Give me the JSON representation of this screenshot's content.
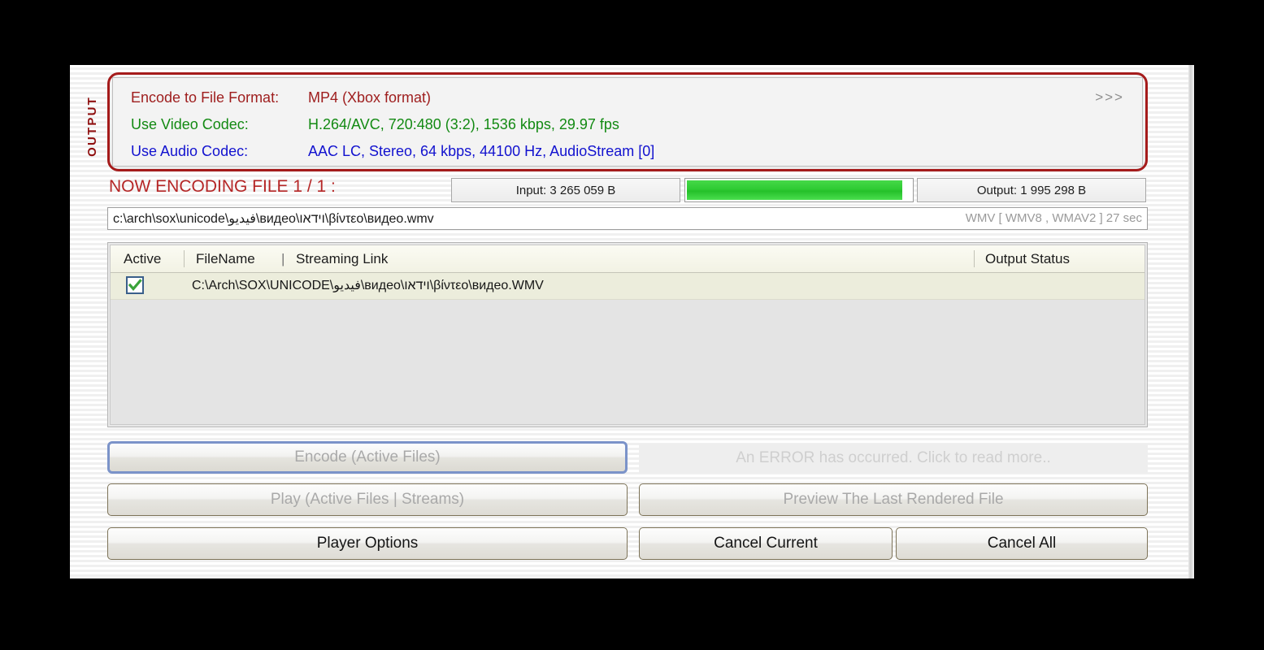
{
  "output_panel": {
    "tab_label": "OUTPUT",
    "more_arrows": ">>>",
    "rows": [
      {
        "label": "Encode to File Format:",
        "value": "MP4 (Xbox format)",
        "color": "#9e1d1d"
      },
      {
        "label": "Use Video Codec:",
        "value": "H.264/AVC,  720:480 (3:2),  1536 kbps,  29.97 fps",
        "color": "#138a13"
      },
      {
        "label": "Use Audio Codec:",
        "value": "AAC LC,  Stereo,  64 kbps,  44100 Hz,  AudioStream [0]",
        "color": "#1212cf"
      }
    ]
  },
  "status": {
    "now_encoding": "NOW ENCODING FILE 1 / 1 :",
    "input_size": "Input: 3 265 059 B",
    "output_size": "Output: 1 995 298 B",
    "progress_percent": 96
  },
  "current_file": {
    "path": "c:\\arch\\sox\\unicode\\فيديو\\видео\\וידאו\\βίντεο\\видео.wmv",
    "info": "WMV [ WMV8 , WMAV2  ] 27 sec"
  },
  "file_list": {
    "headers": {
      "active": "Active",
      "filename": "FileName",
      "separator": "|",
      "streaming_link": "Streaming Link",
      "output_status": "Output Status"
    },
    "rows": [
      {
        "active": true,
        "filename": "C:\\Arch\\SOX\\UNICODE\\فيديو\\видео\\וידאו\\βίντεο\\видео.WMV",
        "output_status": ""
      }
    ]
  },
  "buttons": {
    "encode": "Encode (Active Files)",
    "play": "Play (Active Files | Streams)",
    "player_options": "Player Options",
    "error": "An ERROR has occurred. Click to read more..",
    "preview": "Preview The Last Rendered File",
    "cancel_current": "Cancel Current",
    "cancel_all": "Cancel All"
  },
  "colors": {
    "accent_red": "#a51b1b",
    "progress_green": "#2fcb33",
    "focus_blue": "#7b93c9"
  }
}
